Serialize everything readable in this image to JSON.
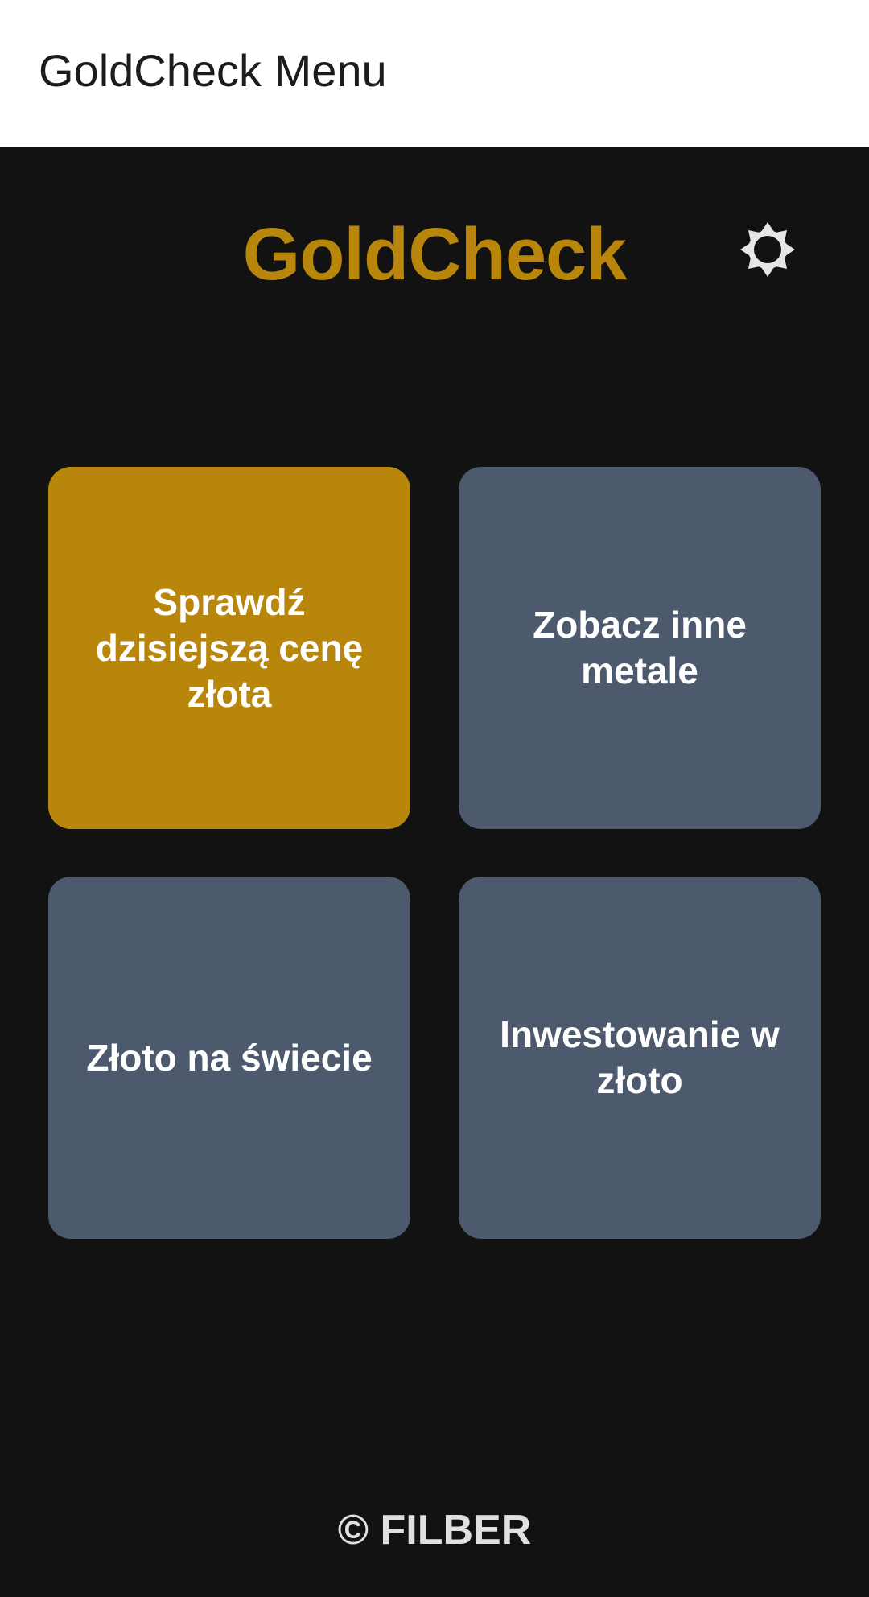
{
  "appbar": {
    "title": "GoldCheck Menu"
  },
  "header": {
    "brand": "GoldCheck",
    "settings_icon": "gear-icon"
  },
  "tiles": [
    {
      "label": "Sprawdź dzisiejszą cenę złota",
      "color": "#b8860b"
    },
    {
      "label": "Zobacz inne metale",
      "color": "#4d596c"
    },
    {
      "label": "Złoto na świecie",
      "color": "#4d596c"
    },
    {
      "label": "Inwestowanie w złoto",
      "color": "#4d596c"
    }
  ],
  "footer": {
    "copyright": "© FILBER"
  },
  "colors": {
    "accent": "#b8860b",
    "background": "#121212",
    "tile": "#4d596c",
    "appbar": "#ffffff"
  }
}
